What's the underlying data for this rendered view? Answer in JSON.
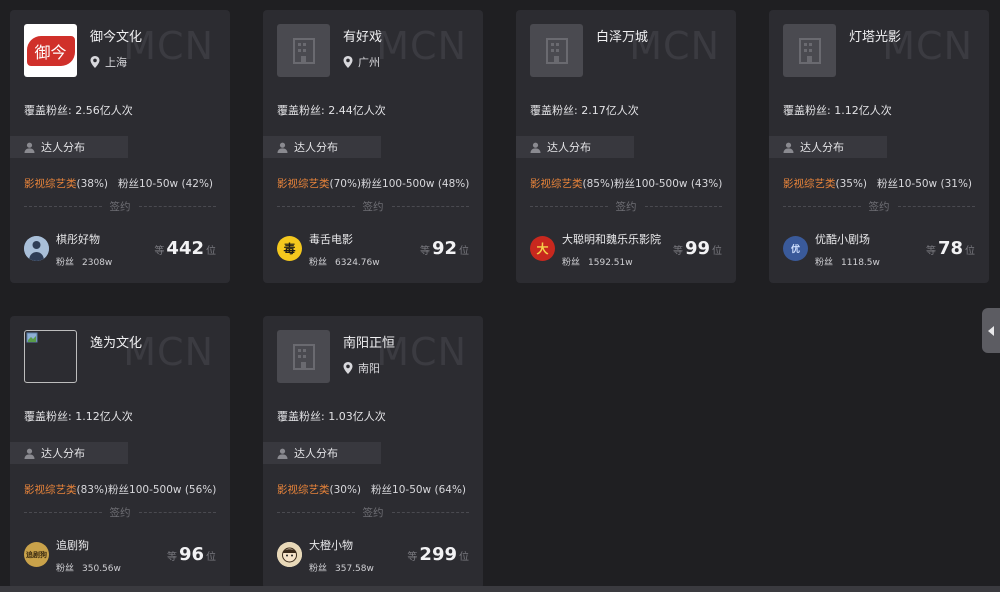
{
  "watermark": "MCN",
  "labels": {
    "cover_prefix": "覆盖粉丝: ",
    "distribution": "达人分布",
    "signed": "签约",
    "fans": "粉丝",
    "rank_prefix": "等",
    "rank_suffix": "位"
  },
  "cards": [
    {
      "name": "御今文化",
      "location": "上海",
      "cover": "2.56亿人次",
      "category": "影视综艺类",
      "category_pct": "(38%)",
      "fans_range": "粉丝10-50w (42%)",
      "kol": {
        "name": "棋彤好物",
        "fans": "2308w",
        "rank": "442",
        "avatar": "person-avatar"
      },
      "logo": "seal-logo",
      "logo_text": "御今"
    },
    {
      "name": "有好戏",
      "location": "广州",
      "cover": "2.44亿人次",
      "category": "影视综艺类",
      "category_pct": "(70%)",
      "fans_range": "粉丝100-500w (48%)",
      "kol": {
        "name": "毒舌电影",
        "fans": "6324.76w",
        "rank": "92",
        "avatar_text": "毒"
      },
      "logo": "building-placeholder"
    },
    {
      "name": "白泽万城",
      "location": "",
      "cover": "2.17亿人次",
      "category": "影视综艺类",
      "category_pct": "(85%)",
      "fans_range": "粉丝100-500w (43%)",
      "kol": {
        "name": "大聪明和魏乐乐影院",
        "fans": "1592.51w",
        "rank": "99",
        "avatar_text": "大"
      },
      "logo": "building-placeholder"
    },
    {
      "name": "灯塔光影",
      "location": "",
      "cover": "1.12亿人次",
      "category": "影视综艺类",
      "category_pct": "(35%)",
      "fans_range": "粉丝10-50w (31%)",
      "kol": {
        "name": "优酷小剧场",
        "fans": "1118.5w",
        "rank": "78",
        "avatar_text": "优"
      },
      "logo": "building-placeholder"
    },
    {
      "name": "逸为文化",
      "location": "",
      "cover": "1.12亿人次",
      "category": "影视综艺类",
      "category_pct": "(83%)",
      "fans_range": "粉丝100-500w (56%)",
      "kol": {
        "name": "追剧狗",
        "fans": "350.56w",
        "rank": "96",
        "avatar_text": "追剧狗"
      },
      "logo": "broken-image"
    },
    {
      "name": "南阳正恒",
      "location": "南阳",
      "cover": "1.03亿人次",
      "category": "影视综艺类",
      "category_pct": "(30%)",
      "fans_range": "粉丝10-50w (64%)",
      "kol": {
        "name": "大橙小物",
        "fans": "357.58w",
        "rank": "299",
        "avatar": "cartoon-avatar"
      },
      "logo": "building-placeholder"
    }
  ],
  "colors": {
    "accent": "#e7833a",
    "card_bg": "#2c2c31",
    "page_bg": "#1f1f22"
  }
}
